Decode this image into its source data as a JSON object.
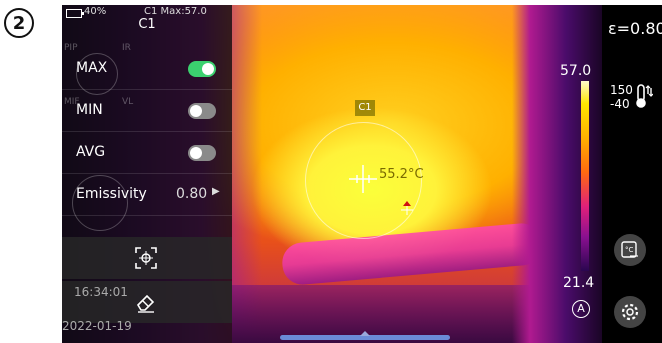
{
  "step_badge": "2",
  "status_bar": {
    "battery": "40%",
    "measure_info": "C1 Max:57.0"
  },
  "menu": {
    "title": "C1",
    "items": [
      {
        "label": "MAX",
        "on": true
      },
      {
        "label": "MIN",
        "on": false
      },
      {
        "label": "AVG",
        "on": false
      }
    ],
    "emissivity_label": "Emissivity",
    "emissivity_value": "0.80",
    "time": "16:34:01",
    "date": "2022-01-19",
    "ghost_labels": [
      "PIP",
      "IR",
      "MIF",
      "VL"
    ]
  },
  "measurement": {
    "tag": "C1",
    "temperature": "55.2°C"
  },
  "scale": {
    "max": "57.0",
    "min": "21.4",
    "auto": "A"
  },
  "right_panel": {
    "emissivity": "ε=0.80",
    "range_high": "150",
    "range_low": "-40"
  },
  "colors": {
    "toggle_on": "#3bd16f",
    "panel_bg": "#000000"
  }
}
